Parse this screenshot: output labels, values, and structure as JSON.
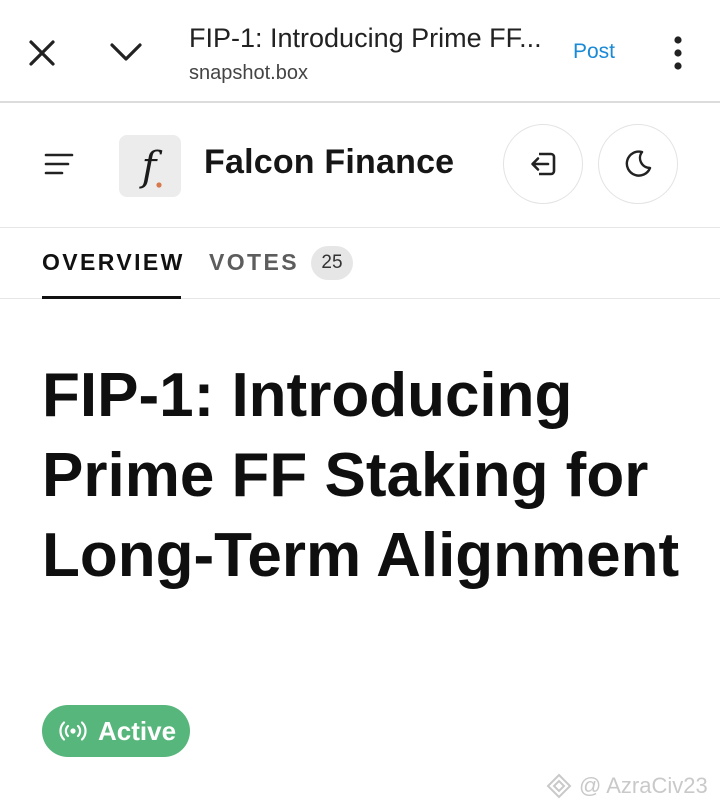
{
  "browser": {
    "page_title": "FIP-1: Introducing Prime FF...",
    "url": "snapshot.box",
    "post_label": "Post"
  },
  "site": {
    "brand_name": "Falcon Finance",
    "logo_glyph": "f"
  },
  "tabs": [
    {
      "label": "OVERVIEW",
      "active": true
    },
    {
      "label": "VOTES",
      "active": false,
      "badge": "25"
    }
  ],
  "proposal": {
    "title": "FIP-1: Introducing Prime FF Staking for Long-Term Alignment",
    "status": "Active"
  },
  "watermark": "@ AzraCiv23",
  "colors": {
    "status_active": "#57b67b",
    "link_blue": "#1a8ad6",
    "logo_dot": "#d7794c"
  }
}
